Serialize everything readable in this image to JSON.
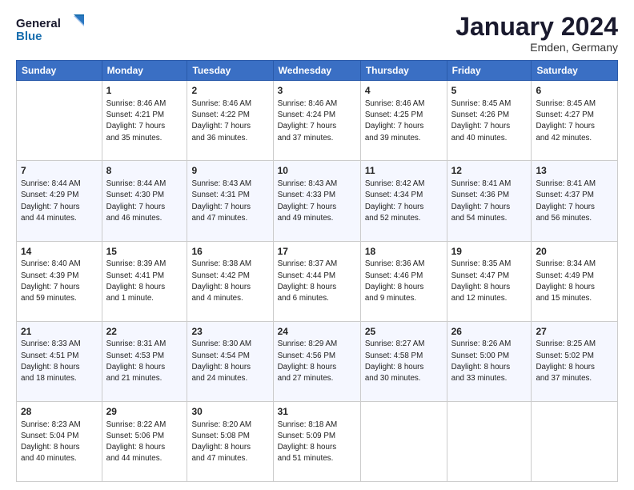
{
  "logo": {
    "line1": "General",
    "line2": "Blue"
  },
  "header": {
    "month": "January 2024",
    "location": "Emden, Germany"
  },
  "columns": [
    "Sunday",
    "Monday",
    "Tuesday",
    "Wednesday",
    "Thursday",
    "Friday",
    "Saturday"
  ],
  "weeks": [
    [
      {
        "day": "",
        "info": ""
      },
      {
        "day": "1",
        "info": "Sunrise: 8:46 AM\nSunset: 4:21 PM\nDaylight: 7 hours\nand 35 minutes."
      },
      {
        "day": "2",
        "info": "Sunrise: 8:46 AM\nSunset: 4:22 PM\nDaylight: 7 hours\nand 36 minutes."
      },
      {
        "day": "3",
        "info": "Sunrise: 8:46 AM\nSunset: 4:24 PM\nDaylight: 7 hours\nand 37 minutes."
      },
      {
        "day": "4",
        "info": "Sunrise: 8:46 AM\nSunset: 4:25 PM\nDaylight: 7 hours\nand 39 minutes."
      },
      {
        "day": "5",
        "info": "Sunrise: 8:45 AM\nSunset: 4:26 PM\nDaylight: 7 hours\nand 40 minutes."
      },
      {
        "day": "6",
        "info": "Sunrise: 8:45 AM\nSunset: 4:27 PM\nDaylight: 7 hours\nand 42 minutes."
      }
    ],
    [
      {
        "day": "7",
        "info": "Sunrise: 8:44 AM\nSunset: 4:29 PM\nDaylight: 7 hours\nand 44 minutes."
      },
      {
        "day": "8",
        "info": "Sunrise: 8:44 AM\nSunset: 4:30 PM\nDaylight: 7 hours\nand 46 minutes."
      },
      {
        "day": "9",
        "info": "Sunrise: 8:43 AM\nSunset: 4:31 PM\nDaylight: 7 hours\nand 47 minutes."
      },
      {
        "day": "10",
        "info": "Sunrise: 8:43 AM\nSunset: 4:33 PM\nDaylight: 7 hours\nand 49 minutes."
      },
      {
        "day": "11",
        "info": "Sunrise: 8:42 AM\nSunset: 4:34 PM\nDaylight: 7 hours\nand 52 minutes."
      },
      {
        "day": "12",
        "info": "Sunrise: 8:41 AM\nSunset: 4:36 PM\nDaylight: 7 hours\nand 54 minutes."
      },
      {
        "day": "13",
        "info": "Sunrise: 8:41 AM\nSunset: 4:37 PM\nDaylight: 7 hours\nand 56 minutes."
      }
    ],
    [
      {
        "day": "14",
        "info": "Sunrise: 8:40 AM\nSunset: 4:39 PM\nDaylight: 7 hours\nand 59 minutes."
      },
      {
        "day": "15",
        "info": "Sunrise: 8:39 AM\nSunset: 4:41 PM\nDaylight: 8 hours\nand 1 minute."
      },
      {
        "day": "16",
        "info": "Sunrise: 8:38 AM\nSunset: 4:42 PM\nDaylight: 8 hours\nand 4 minutes."
      },
      {
        "day": "17",
        "info": "Sunrise: 8:37 AM\nSunset: 4:44 PM\nDaylight: 8 hours\nand 6 minutes."
      },
      {
        "day": "18",
        "info": "Sunrise: 8:36 AM\nSunset: 4:46 PM\nDaylight: 8 hours\nand 9 minutes."
      },
      {
        "day": "19",
        "info": "Sunrise: 8:35 AM\nSunset: 4:47 PM\nDaylight: 8 hours\nand 12 minutes."
      },
      {
        "day": "20",
        "info": "Sunrise: 8:34 AM\nSunset: 4:49 PM\nDaylight: 8 hours\nand 15 minutes."
      }
    ],
    [
      {
        "day": "21",
        "info": "Sunrise: 8:33 AM\nSunset: 4:51 PM\nDaylight: 8 hours\nand 18 minutes."
      },
      {
        "day": "22",
        "info": "Sunrise: 8:31 AM\nSunset: 4:53 PM\nDaylight: 8 hours\nand 21 minutes."
      },
      {
        "day": "23",
        "info": "Sunrise: 8:30 AM\nSunset: 4:54 PM\nDaylight: 8 hours\nand 24 minutes."
      },
      {
        "day": "24",
        "info": "Sunrise: 8:29 AM\nSunset: 4:56 PM\nDaylight: 8 hours\nand 27 minutes."
      },
      {
        "day": "25",
        "info": "Sunrise: 8:27 AM\nSunset: 4:58 PM\nDaylight: 8 hours\nand 30 minutes."
      },
      {
        "day": "26",
        "info": "Sunrise: 8:26 AM\nSunset: 5:00 PM\nDaylight: 8 hours\nand 33 minutes."
      },
      {
        "day": "27",
        "info": "Sunrise: 8:25 AM\nSunset: 5:02 PM\nDaylight: 8 hours\nand 37 minutes."
      }
    ],
    [
      {
        "day": "28",
        "info": "Sunrise: 8:23 AM\nSunset: 5:04 PM\nDaylight: 8 hours\nand 40 minutes."
      },
      {
        "day": "29",
        "info": "Sunrise: 8:22 AM\nSunset: 5:06 PM\nDaylight: 8 hours\nand 44 minutes."
      },
      {
        "day": "30",
        "info": "Sunrise: 8:20 AM\nSunset: 5:08 PM\nDaylight: 8 hours\nand 47 minutes."
      },
      {
        "day": "31",
        "info": "Sunrise: 8:18 AM\nSunset: 5:09 PM\nDaylight: 8 hours\nand 51 minutes."
      },
      {
        "day": "",
        "info": ""
      },
      {
        "day": "",
        "info": ""
      },
      {
        "day": "",
        "info": ""
      }
    ]
  ]
}
